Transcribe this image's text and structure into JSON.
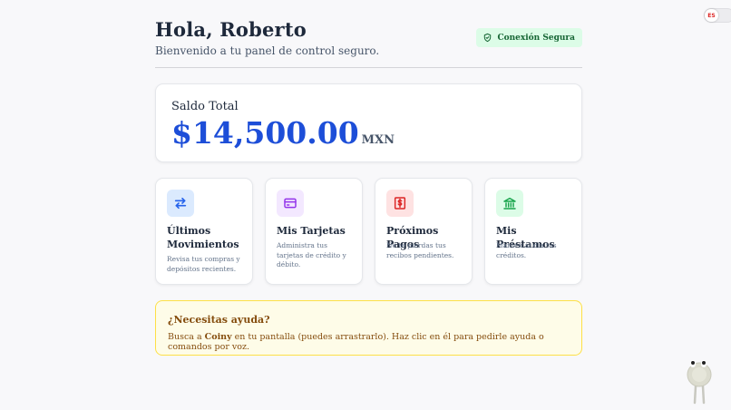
{
  "language_toggle": {
    "label": "ES"
  },
  "header": {
    "greeting": "Hola, Roberto",
    "welcome": "Bienvenido a tu panel de control seguro.",
    "secure_badge": "Conexión Segura"
  },
  "balance": {
    "label": "Saldo Total",
    "amount": "$14,500.00",
    "currency": "MXN"
  },
  "cards": [
    {
      "title": "Últimos Movimientos",
      "description": "Revisa tus compras y depósitos recientes.",
      "icon": "arrows-exchange-icon",
      "icon_color": "#2563eb",
      "icon_bg": "#dbeafe"
    },
    {
      "title": "Mis Tarjetas",
      "description": "Administra tus tarjetas de crédito y débito.",
      "icon": "credit-card-icon",
      "icon_color": "#9333ea",
      "icon_bg": "#f3e8ff"
    },
    {
      "title": "Próximos Pagos",
      "description": "No te pierdas tus recibos pendientes.",
      "icon": "dollar-receipt-icon",
      "icon_color": "#dc2626",
      "icon_bg": "#fee2e2"
    },
    {
      "title": "Mis Préstamos",
      "description": "Mantén al día tus créditos.",
      "icon": "bank-icon",
      "icon_color": "#16a34a",
      "icon_bg": "#dcfce7"
    }
  ],
  "help": {
    "title": "¿Necesitas ayuda?",
    "text_before": "Busca a ",
    "assistant_name": "Coiny",
    "text_after": " en tu pantalla (puedes arrastrarlo). Haz clic en él para pedirle ayuda o comandos por voz."
  },
  "colors": {
    "accent": "#1d4ed8",
    "secure": "#166534",
    "help_text": "#854d0e"
  }
}
